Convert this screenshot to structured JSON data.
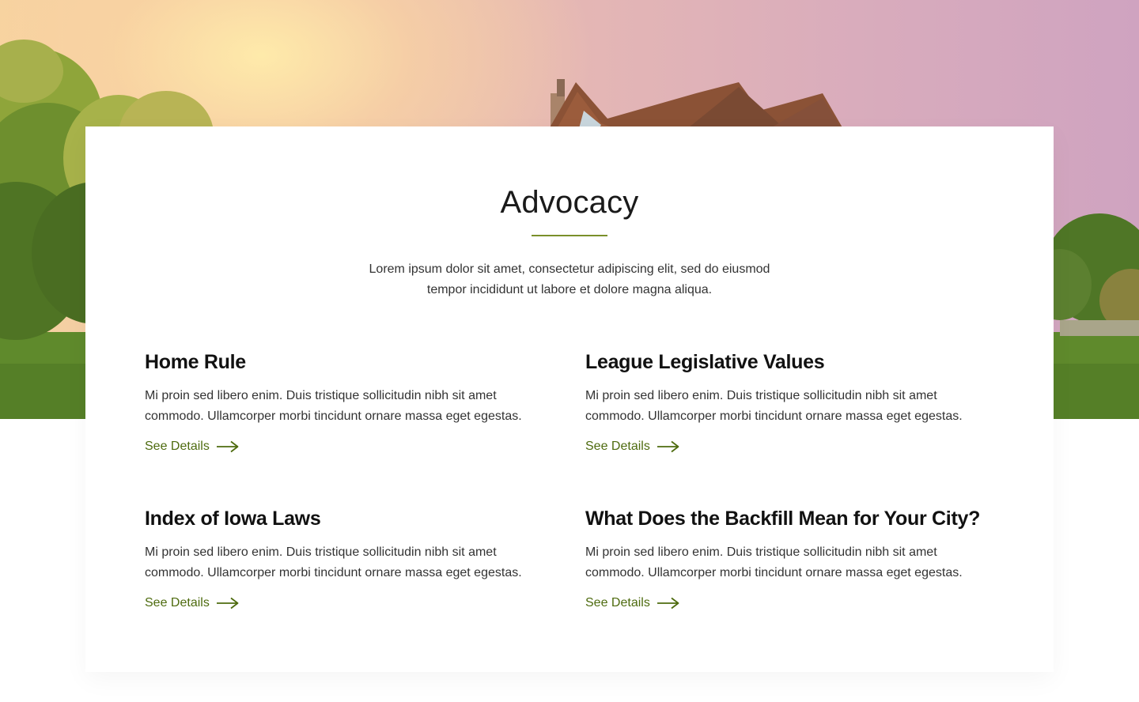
{
  "section": {
    "title": "Advocacy",
    "intro": "Lorem ipsum dolor sit amet, consectetur adipiscing elit, sed do eiusmod tempor incididunt ut labore et dolore magna aliqua."
  },
  "items": [
    {
      "title": "Home Rule",
      "description": "Mi proin sed libero enim. Duis tristique sollicitudin nibh sit amet commodo. Ullamcorper morbi tincidunt ornare massa eget egestas.",
      "link_label": "See Details"
    },
    {
      "title": "League Legislative Values",
      "description": "Mi proin sed libero enim. Duis tristique sollicitudin nibh sit amet commodo. Ullamcorper morbi tincidunt ornare massa eget egestas.",
      "link_label": "See Details"
    },
    {
      "title": "Index of Iowa Laws",
      "description": "Mi proin sed libero enim. Duis tristique sollicitudin nibh sit amet commodo. Ullamcorper morbi tincidunt ornare massa eget egestas.",
      "link_label": "See Details"
    },
    {
      "title": "What Does the Backfill Mean for Your City?",
      "description": "Mi proin sed libero enim. Duis tristique sollicitudin nibh sit amet commodo. Ullamcorper morbi tincidunt ornare massa eget egestas.",
      "link_label": "See Details"
    }
  ],
  "colors": {
    "accent": "#4e6b0f",
    "rule": "#7a8f2a",
    "heading": "#111111",
    "body_text": "#333333"
  },
  "icons": {
    "link_icon": "arrow-right-icon"
  }
}
